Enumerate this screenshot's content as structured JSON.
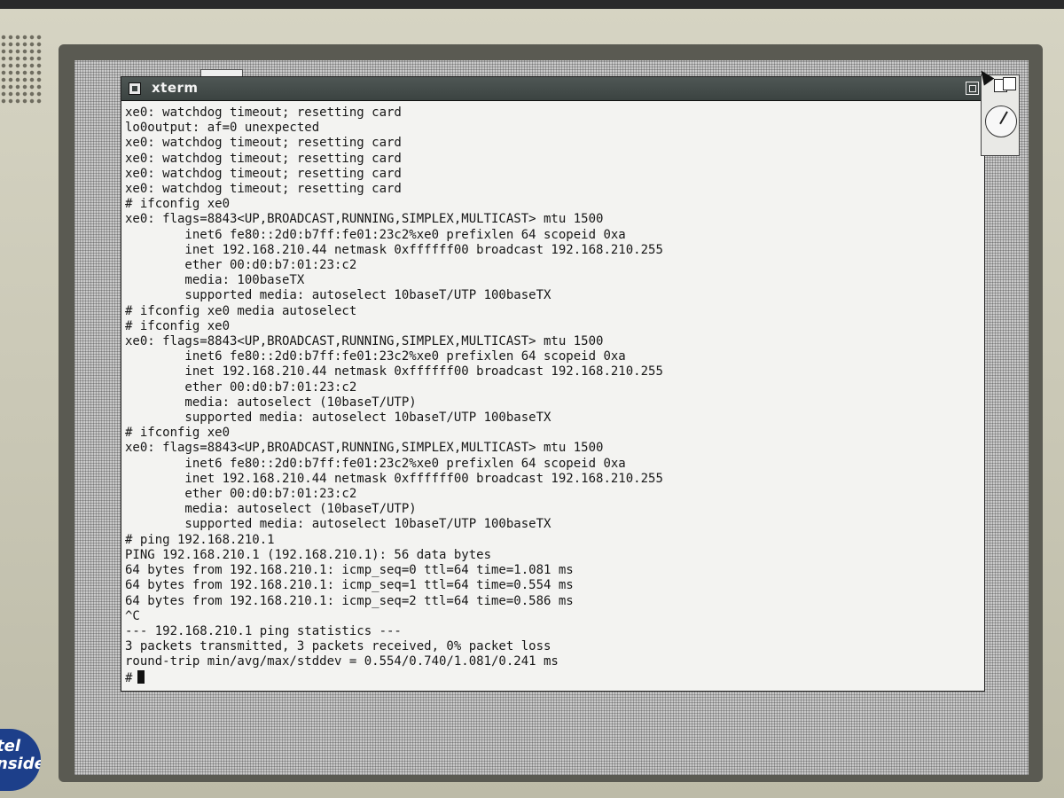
{
  "window": {
    "title": "xterm"
  },
  "hardware": {
    "badge_line1": "tel",
    "badge_line2": "nside"
  },
  "terminal": {
    "lines": [
      "xe0: watchdog timeout; resetting card",
      "lo0output: af=0 unexpected",
      "xe0: watchdog timeout; resetting card",
      "xe0: watchdog timeout; resetting card",
      "xe0: watchdog timeout; resetting card",
      "xe0: watchdog timeout; resetting card",
      "# ifconfig xe0",
      "xe0: flags=8843<UP,BROADCAST,RUNNING,SIMPLEX,MULTICAST> mtu 1500",
      "        inet6 fe80::2d0:b7ff:fe01:23c2%xe0 prefixlen 64 scopeid 0xa",
      "        inet 192.168.210.44 netmask 0xffffff00 broadcast 192.168.210.255",
      "        ether 00:d0:b7:01:23:c2",
      "        media: 100baseTX",
      "        supported media: autoselect 10baseT/UTP 100baseTX",
      "# ifconfig xe0 media autoselect",
      "# ifconfig xe0",
      "xe0: flags=8843<UP,BROADCAST,RUNNING,SIMPLEX,MULTICAST> mtu 1500",
      "        inet6 fe80::2d0:b7ff:fe01:23c2%xe0 prefixlen 64 scopeid 0xa",
      "        inet 192.168.210.44 netmask 0xffffff00 broadcast 192.168.210.255",
      "        ether 00:d0:b7:01:23:c2",
      "        media: autoselect (10baseT/UTP)",
      "        supported media: autoselect 10baseT/UTP 100baseTX",
      "# ifconfig xe0",
      "xe0: flags=8843<UP,BROADCAST,RUNNING,SIMPLEX,MULTICAST> mtu 1500",
      "        inet6 fe80::2d0:b7ff:fe01:23c2%xe0 prefixlen 64 scopeid 0xa",
      "        inet 192.168.210.44 netmask 0xffffff00 broadcast 192.168.210.255",
      "        ether 00:d0:b7:01:23:c2",
      "        media: autoselect (10baseT/UTP)",
      "        supported media: autoselect 10baseT/UTP 100baseTX",
      "# ping 192.168.210.1",
      "PING 192.168.210.1 (192.168.210.1): 56 data bytes",
      "64 bytes from 192.168.210.1: icmp_seq=0 ttl=64 time=1.081 ms",
      "64 bytes from 192.168.210.1: icmp_seq=1 ttl=64 time=0.554 ms",
      "64 bytes from 192.168.210.1: icmp_seq=2 ttl=64 time=0.586 ms",
      "^C",
      "--- 192.168.210.1 ping statistics ---",
      "3 packets transmitted, 3 packets received, 0% packet loss",
      "round-trip min/avg/max/stddev = 0.554/0.740/1.081/0.241 ms"
    ],
    "prompt": "#"
  },
  "icons": {
    "window_menu": "window-menu-icon",
    "maximize": "maximize-icon",
    "iconify": "iconify-icon",
    "clock": "clock-icon",
    "pointer": "mouse-pointer-icon"
  }
}
